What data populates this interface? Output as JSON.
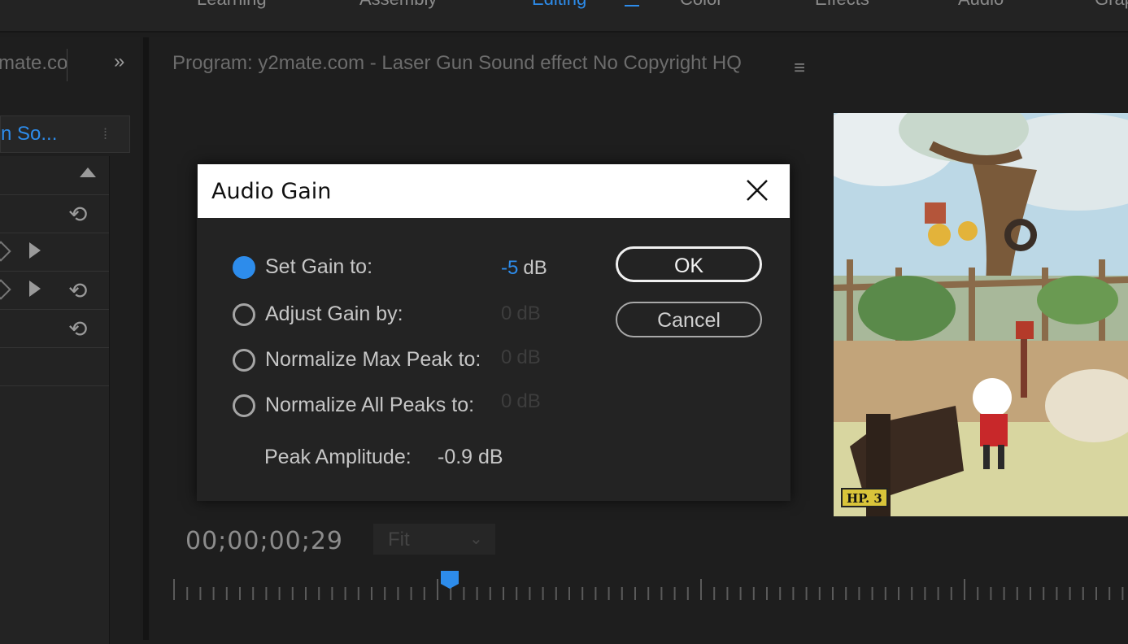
{
  "workspace": {
    "tabs": [
      {
        "label": "Learning"
      },
      {
        "label": "Assembly"
      },
      {
        "label": "Editing"
      },
      {
        "label": "Color"
      },
      {
        "label": "Effects"
      },
      {
        "label": "Audio"
      },
      {
        "label": "Grap"
      }
    ],
    "active_tab": "Editing"
  },
  "left_panel": {
    "title": "mate.co",
    "tab_label": "n  So..."
  },
  "program_monitor": {
    "title": "Program: y2mate.com - Laser Gun  Sound effect  No Copyright HQ",
    "timecode": "00;00;00;29",
    "fit_value": "Fit",
    "video_badge": "HP. 3"
  },
  "dialog": {
    "title": "Audio Gain",
    "options": [
      {
        "label": "Set Gain to:",
        "value": "-5",
        "unit": "dB",
        "selected": true
      },
      {
        "label": "Adjust Gain by:",
        "value": "0",
        "unit": "dB",
        "selected": false
      },
      {
        "label": "Normalize Max Peak to:",
        "value": "0",
        "unit": "dB",
        "selected": false
      },
      {
        "label": "Normalize All Peaks to:",
        "value": "0",
        "unit": "dB",
        "selected": false
      }
    ],
    "peak_label": "Peak Amplitude:",
    "peak_value": "-0.9 dB",
    "ok_label": "OK",
    "cancel_label": "Cancel"
  },
  "colors": {
    "accent": "#2d8ceb",
    "panel_bg": "#1e1e1e",
    "dialog_bg": "#232323"
  }
}
